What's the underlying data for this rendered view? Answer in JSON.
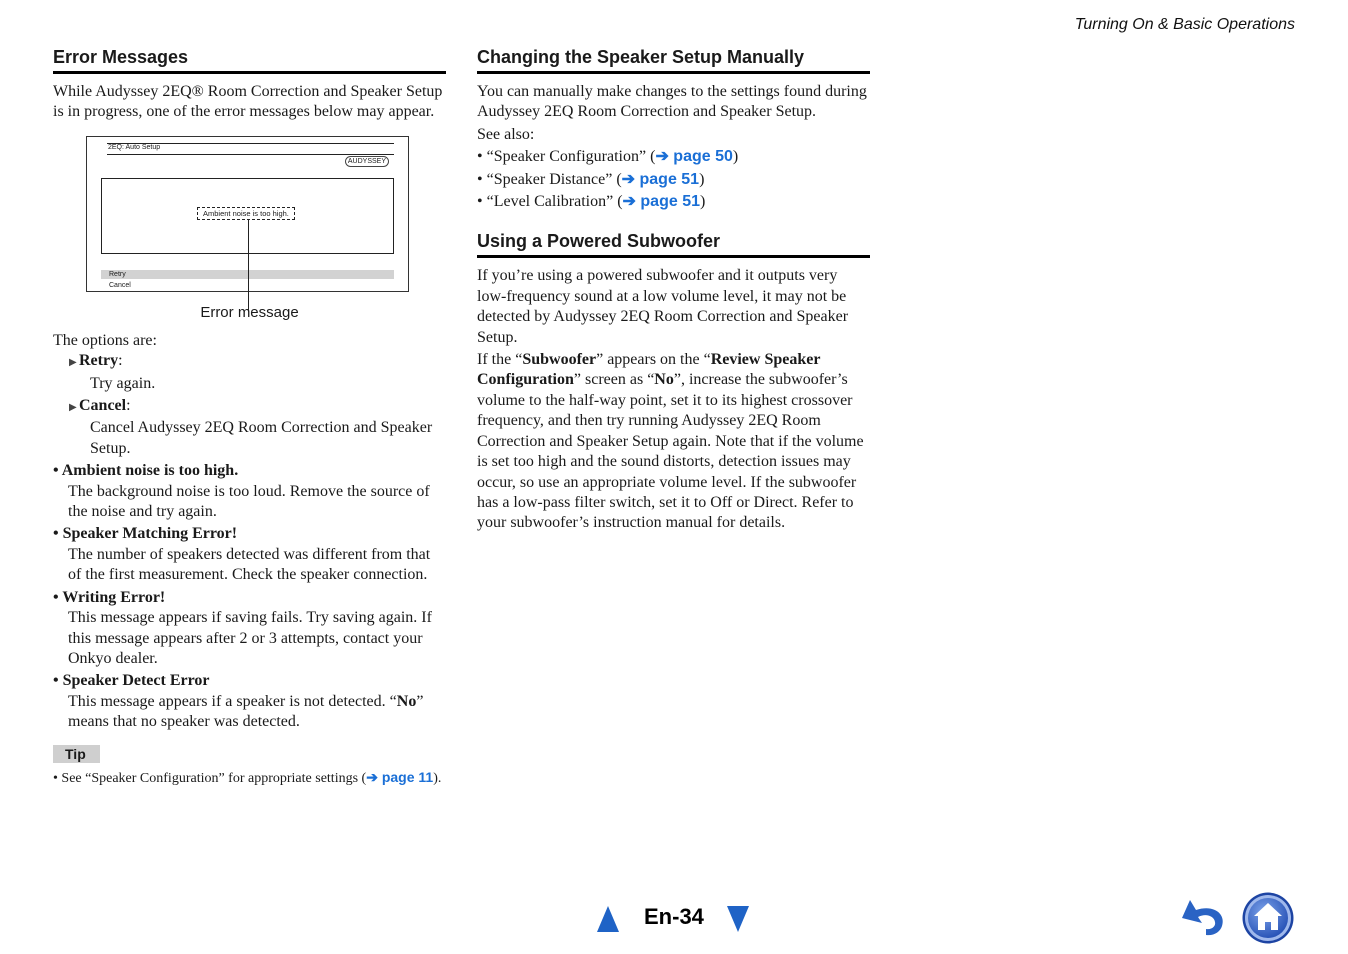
{
  "running_head": "Turning On & Basic Operations",
  "left": {
    "heading": "Error Messages",
    "intro": "While Audyssey 2EQ® Room Correction and Speaker Setup is in progress, one of the error messages below may appear.",
    "screen": {
      "title": "2EQ: Auto Setup",
      "logo": "AUDYSSEY",
      "message": "Ambient noise is too high.",
      "options": [
        "Retry",
        "Cancel"
      ],
      "caption": "Error message"
    },
    "options_intro": "The options are:",
    "options": [
      {
        "label": "Retry",
        "desc": "Try again."
      },
      {
        "label": "Cancel",
        "desc": "Cancel Audyssey 2EQ Room Correction and Speaker Setup."
      }
    ],
    "errors": [
      {
        "title": "Ambient noise is too high.",
        "desc": "The background noise is too loud. Remove the source of the noise and try again."
      },
      {
        "title": "Speaker Matching Error!",
        "desc": "The number of speakers detected was different from that of the first measurement. Check the speaker connection."
      },
      {
        "title": "Writing Error!",
        "desc": "This message appears if saving fails. Try saving again. If this message appears after 2 or 3 attempts, contact your Onkyo dealer."
      },
      {
        "title": "Speaker Detect Error",
        "desc_pre": "This message appears if a speaker is not detected. “",
        "desc_bold": "No",
        "desc_post": "” means that no speaker was detected."
      }
    ],
    "tip": {
      "label": "Tip",
      "text_pre": "See “Speaker Configuration” for appropriate settings (",
      "link": "➔ page 11",
      "text_post": ")."
    }
  },
  "right": {
    "heading1": "Changing the Speaker Setup Manually",
    "para1": "You can manually make changes to the settings found during Audyssey 2EQ Room Correction and Speaker Setup.",
    "see_also": "See also:",
    "see_list": [
      {
        "pre": "• “Speaker Configuration” (",
        "link": "➔ page 50",
        "post": ")"
      },
      {
        "pre": "• “Speaker Distance” (",
        "link": "➔ page 51",
        "post": ")"
      },
      {
        "pre": "• “Level Calibration” (",
        "link": "➔ page 51",
        "post": ")"
      }
    ],
    "heading2": "Using a Powered Subwoofer",
    "para2": "If you’re using a powered subwoofer and it outputs very low-frequency sound at a low volume level, it may not be detected by Audyssey 2EQ Room Correction and Speaker Setup.",
    "para3": {
      "t1": "If the “",
      "b1": "Subwoofer",
      "t2": "” appears on the “",
      "b2": "Review Speaker Configuration",
      "t3": "” screen as “",
      "b3": "No",
      "t4": "”, increase the subwoofer’s volume to the half-way point, set it to its highest crossover frequency, and then try running Audyssey 2EQ Room Correction and Speaker Setup again. Note that if the volume is set too high and the sound distorts, detection issues may occur, so use an appropriate volume level. If the subwoofer has a low-pass filter switch, set it to Off or Direct. Refer to your subwoofer’s instruction manual for details."
    }
  },
  "footer": {
    "page_label": "En-34",
    "prev_icon": "triangle-up-icon",
    "next_icon": "triangle-down-icon",
    "back_icon": "back-arrow-icon",
    "home_icon": "home-icon",
    "accent_color": "#1f63c6",
    "link_color": "#1a6fd6"
  }
}
